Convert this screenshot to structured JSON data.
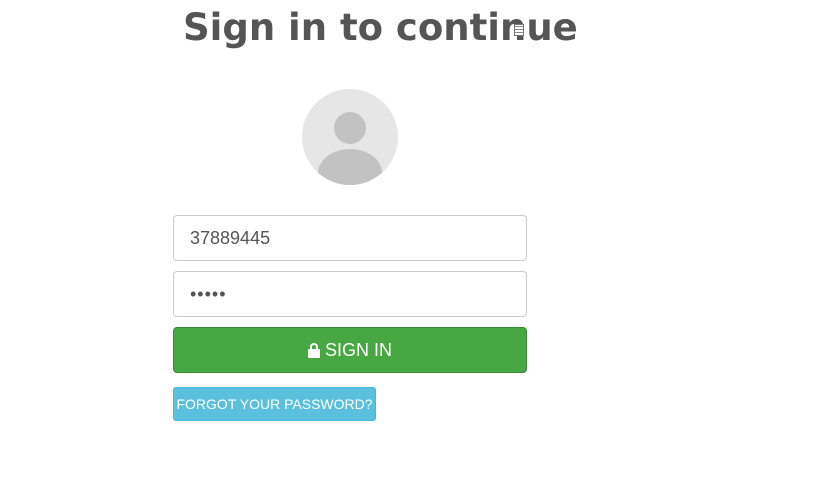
{
  "heading": {
    "title": "Sign in to continue"
  },
  "form": {
    "username_value": "37889445",
    "password_value": "•••••",
    "signin_label": "SIGN IN",
    "signin_icon": "lock-icon",
    "forgot_label": "FORGOT YOUR PASSWORD?"
  },
  "avatar": {
    "icon": "user-placeholder-icon"
  },
  "colors": {
    "heading_text": "#555555",
    "signin_button": "#47a843",
    "forgot_button": "#5bc0de",
    "avatar_bg": "#e6e6e6",
    "avatar_fg": "#c2c2c2"
  }
}
